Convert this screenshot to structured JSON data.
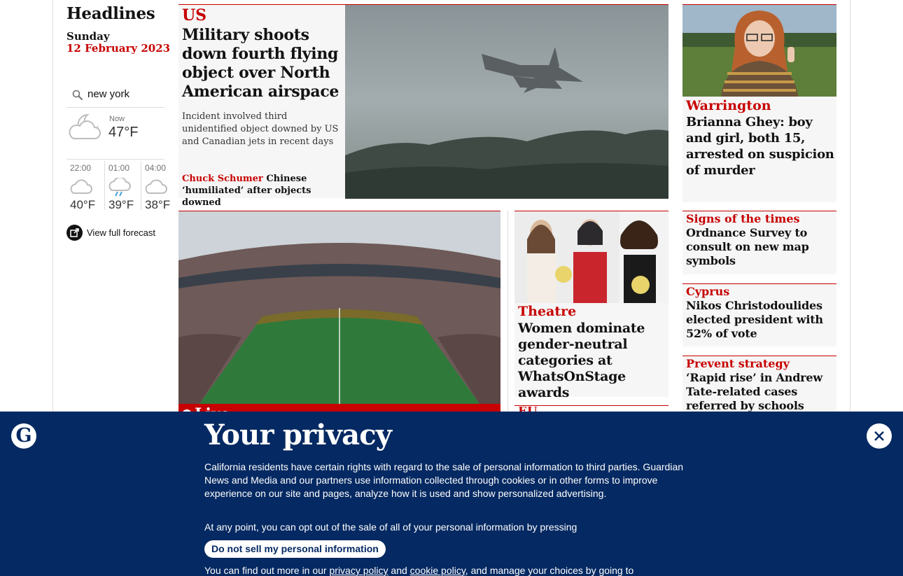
{
  "sidebar": {
    "title": "Headlines",
    "day": "Sunday",
    "date": "12 February 2023"
  },
  "weather": {
    "location": "new york",
    "now": {
      "label": "Now",
      "temp": "47°F",
      "icon": "partly-cloudy-night-icon"
    },
    "forecast": [
      {
        "time": "22:00",
        "temp": "40°F",
        "icon": "cloud-icon"
      },
      {
        "time": "01:00",
        "temp": "39°F",
        "icon": "rain-cloud-icon"
      },
      {
        "time": "04:00",
        "temp": "38°F",
        "icon": "cloud-icon"
      }
    ],
    "full_forecast_label": "View full forecast"
  },
  "main_story": {
    "kicker": "US",
    "headline": "Military shoots down fourth flying object over North American airspace",
    "standfirst": "Incident involved third unidentified object downed by US and Canadian jets in recent days",
    "sublink_kicker": "Chuck Schumer",
    "sublink_text": "Chinese ‘humiliated’ after objects downed"
  },
  "superbowl_story": {
    "live_label": "Live"
  },
  "theatre_story": {
    "kicker": "Theatre",
    "headline": "Women dominate gender-neutral categories at WhatsOnStage awards"
  },
  "eu_story": {
    "kicker": "EU"
  },
  "right_top_story": {
    "kicker": "Warrington",
    "headline": "Brianna Ghey: boy and girl, both 15, arrested on suspicion of murder"
  },
  "small_cards": [
    {
      "kicker": "Signs of the times",
      "headline": "Ordnance Survey to consult on new map symbols"
    },
    {
      "kicker": "Cyprus",
      "headline": "Nikos Christodoulides elected president with 52% of vote"
    },
    {
      "kicker": "Prevent strategy",
      "headline": "‘Rapid rise’ in Andrew Tate-related cases referred by schools"
    }
  ],
  "privacy": {
    "title": "Your privacy",
    "paragraph1": "California residents have certain rights with regard to the sale of personal information to third parties. Guardian News and Media and our partners use information collected through cookies or in other forms to improve experience on our site and pages, analyze how it is used and show personalized advertising.",
    "paragraph2": "At any point, you can opt out of the sale of all of your personal information by pressing",
    "dns_button": "Do not sell my personal information",
    "paragraph3_start": "You can find out more in our ",
    "privacy_link": "privacy policy",
    "paragraph3_mid": " and ",
    "cookie_link": "cookie policy",
    "paragraph3_end": ", and manage your choices by going to"
  },
  "colors": {
    "accent_red": "#c70000",
    "privacy_blue": "#052962",
    "card_bg": "#f6f6f6"
  }
}
